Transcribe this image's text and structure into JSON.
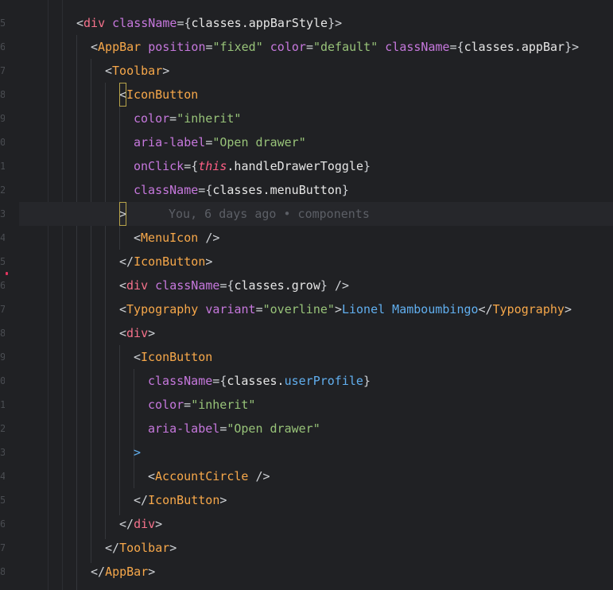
{
  "editor": {
    "gutter_numbers": [
      "5",
      "6",
      "7",
      "8",
      "9",
      "0",
      "1",
      "2",
      "3",
      "4",
      "5",
      "6",
      "7",
      "8",
      "9",
      "0",
      "1",
      "2",
      "3",
      "4",
      "5",
      "6",
      "7",
      "8"
    ],
    "blame_annotation": "You, 6 days ago • components",
    "lines": {
      "l1": {
        "open": "<",
        "tag": "div",
        "attr": "className",
        "eq": "=",
        "lbrace": "{",
        "value": "classes.appBarStyle",
        "rbrace": "}",
        "close": ">"
      },
      "l2": {
        "open": "<",
        "tag": "AppBar",
        "attr1": "position",
        "eq1": "=",
        "str1": "\"fixed\"",
        "attr2": "color",
        "eq2": "=",
        "str2": "\"default\"",
        "attr3": "className",
        "eq3": "=",
        "lbrace": "{",
        "value": "classes.appBar",
        "rbrace": "}",
        "close": ">"
      },
      "l3": {
        "open": "<",
        "tag": "Toolbar",
        "close": ">"
      },
      "l4": {
        "open": "<",
        "tag": "IconButton"
      },
      "l5": {
        "attr": "color",
        "eq": "=",
        "str": "\"inherit\""
      },
      "l6": {
        "attr": "aria-label",
        "eq": "=",
        "str": "\"Open drawer\""
      },
      "l7": {
        "attr": "onClick",
        "eq": "=",
        "lbrace": "{",
        "kw": "this",
        "value": ".handleDrawerToggle",
        "rbrace": "}"
      },
      "l8": {
        "attr": "className",
        "eq": "=",
        "lbrace": "{",
        "value": "classes.menuButton",
        "rbrace": "}"
      },
      "l9": {
        "close": ">"
      },
      "l10": {
        "open": "<",
        "tag": "MenuIcon",
        "selfclose": "/>"
      },
      "l11": {
        "open": "</",
        "tag": "IconButton",
        "close": ">"
      },
      "l12": {
        "open": "<",
        "tag": "div",
        "attr": "className",
        "eq": "=",
        "lbrace": "{",
        "value": "classes.grow",
        "rbrace": "}",
        "selfclose": "/>"
      },
      "l13": {
        "open": "<",
        "tag": "Typography",
        "attr": "variant",
        "eq": "=",
        "str": "\"overline\"",
        "close": ">",
        "text": "Lionel Mamboumbingo",
        "endopen": "</",
        "endtag": "Typography",
        "endclose": ">"
      },
      "l14": {
        "open": "<",
        "tag": "div",
        "close": ">"
      },
      "l15": {
        "open": "<",
        "tag": "IconButton"
      },
      "l16": {
        "attr": "className",
        "eq": "=",
        "lbrace": "{",
        "obj": "classes.",
        "prop": "userProfile",
        "rbrace": "}"
      },
      "l17": {
        "attr": "color",
        "eq": "=",
        "str": "\"inherit\""
      },
      "l18": {
        "attr": "aria-label",
        "eq": "=",
        "str": "\"Open drawer\""
      },
      "l19": {
        "close": ">"
      },
      "l20": {
        "open": "<",
        "tag": "AccountCircle",
        "selfclose": "/>"
      },
      "l21": {
        "open": "</",
        "tag": "IconButton",
        "close": ">"
      },
      "l22": {
        "open": "</",
        "tag": "div",
        "close": ">"
      },
      "l23": {
        "open": "</",
        "tag": "Toolbar",
        "close": ">"
      },
      "l24": {
        "open": "</",
        "tag": "AppBar",
        "close": ">"
      }
    }
  }
}
